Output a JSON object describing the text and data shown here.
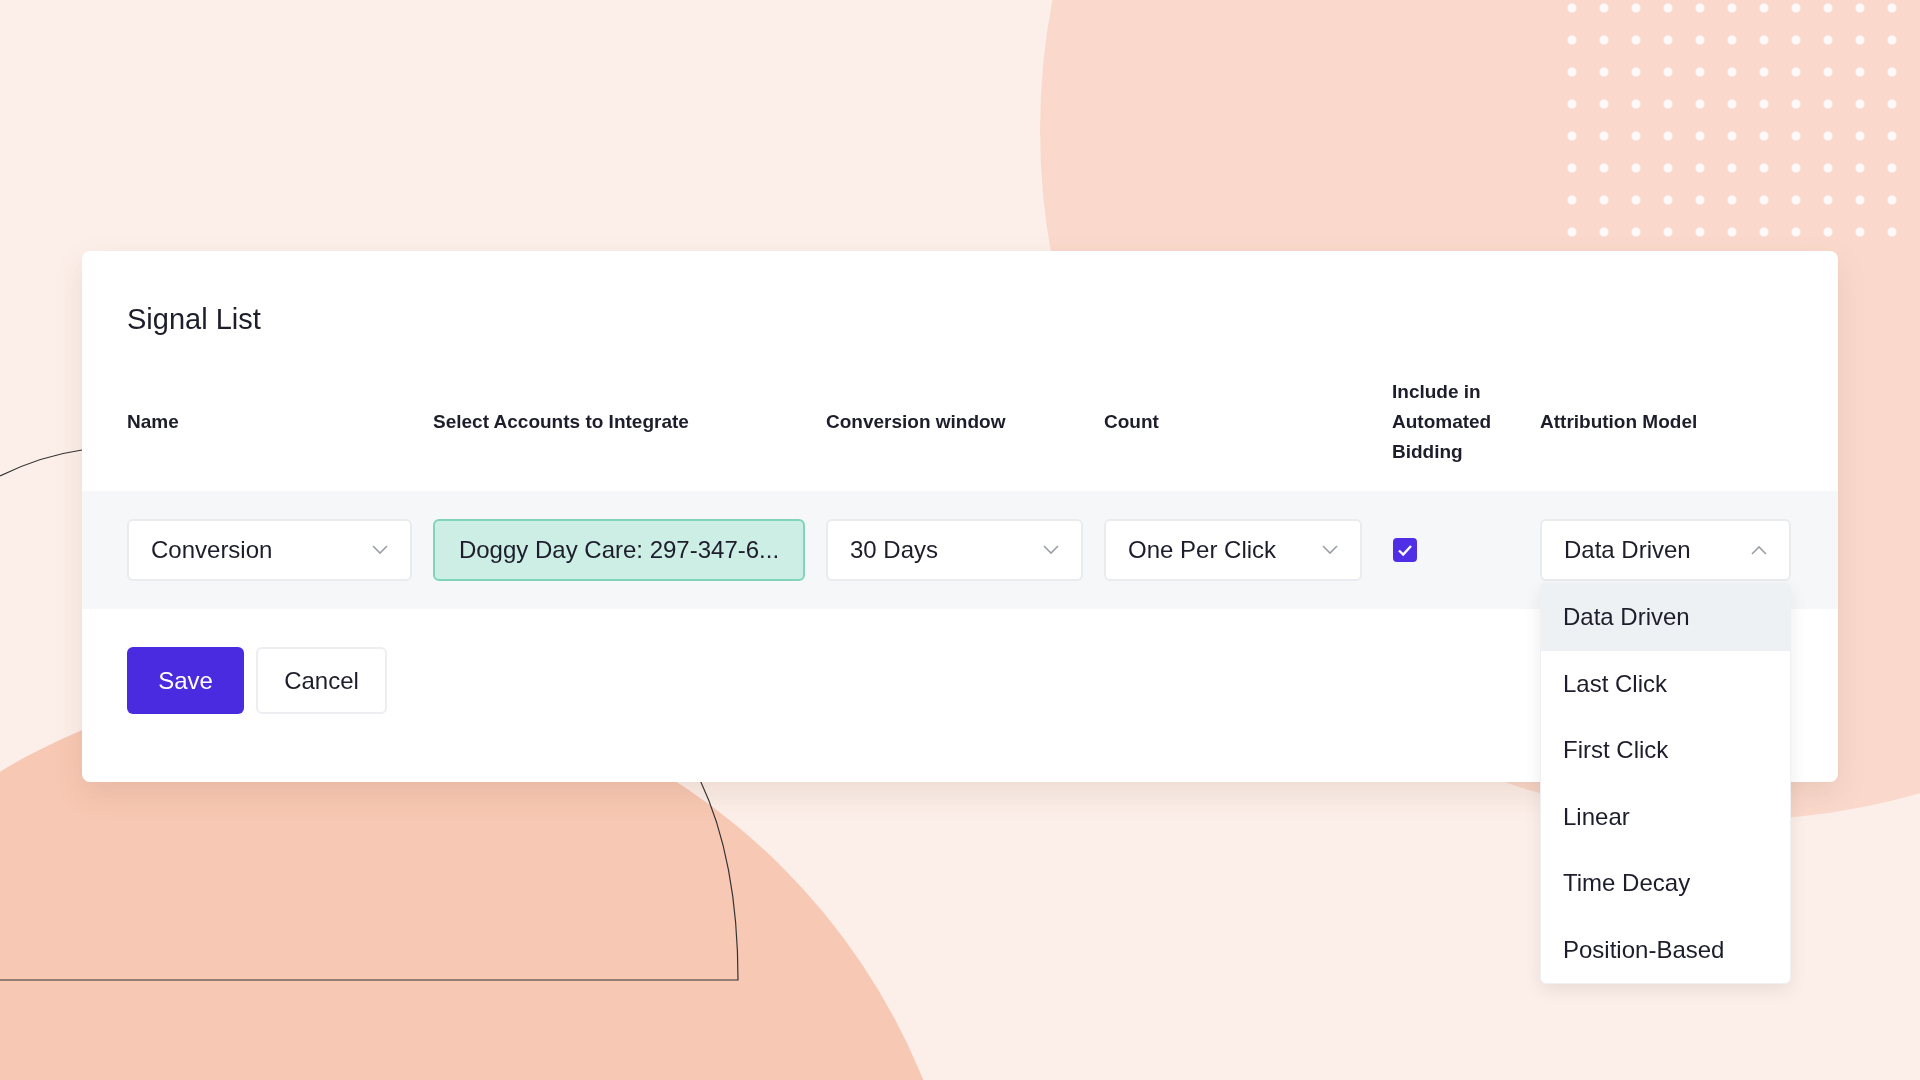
{
  "card": {
    "title": "Signal List",
    "columns": [
      "Name",
      "Select Accounts to Integrate",
      "Conversion window",
      "Count",
      "Include in Automated Bidding",
      "Attribution Model"
    ],
    "row": {
      "name": {
        "value": "Conversion"
      },
      "accounts": {
        "value": "Doggy Day Care: 297-347-6...",
        "focused": true
      },
      "window": {
        "value": "30 Days"
      },
      "count": {
        "value": "One Per Click"
      },
      "automated_bidding": {
        "checked": true
      },
      "attribution": {
        "value": "Data Driven",
        "expanded": true,
        "options": [
          {
            "label": "Data Driven",
            "selected": true
          },
          {
            "label": "Last Click",
            "selected": false
          },
          {
            "label": "First Click",
            "selected": false
          },
          {
            "label": "Linear",
            "selected": false
          },
          {
            "label": "Time Decay",
            "selected": false
          },
          {
            "label": "Position-Based",
            "selected": false
          }
        ]
      }
    },
    "buttons": [
      {
        "label": "Save",
        "kind": "primary"
      },
      {
        "label": "Cancel",
        "kind": "secondary"
      }
    ]
  }
}
